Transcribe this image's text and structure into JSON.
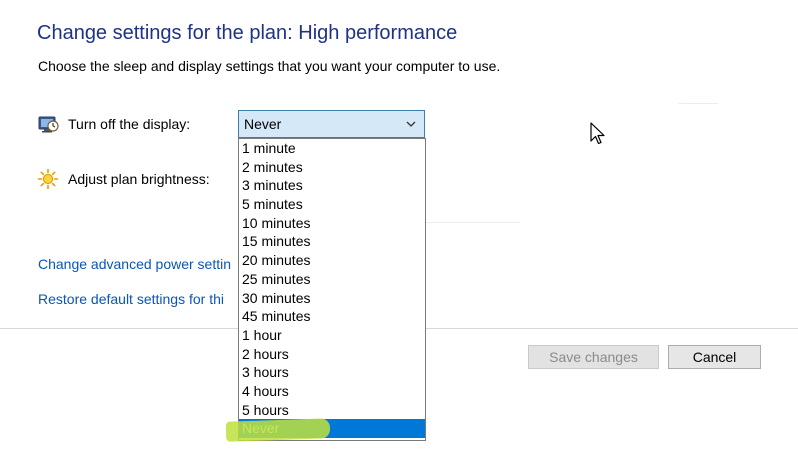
{
  "page": {
    "title": "Change settings for the plan: High performance",
    "subtitle": "Choose the sleep and display settings that you want your computer to use."
  },
  "settings": {
    "display": {
      "label": "Turn off the display:",
      "icon": "monitor-clock-icon",
      "value": "Never"
    },
    "brightness": {
      "label": "Adjust plan brightness:",
      "icon": "sun-icon"
    }
  },
  "dropdown": {
    "options": [
      "1 minute",
      "2 minutes",
      "3 minutes",
      "5 minutes",
      "10 minutes",
      "15 minutes",
      "20 minutes",
      "25 minutes",
      "30 minutes",
      "45 minutes",
      "1 hour",
      "2 hours",
      "3 hours",
      "4 hours",
      "5 hours",
      "Never"
    ],
    "selected": "Never",
    "highlight_color": "#0078d7"
  },
  "links": {
    "advanced": "Change advanced power settin",
    "restore": "Restore default settings for thi"
  },
  "buttons": {
    "save": "Save changes",
    "cancel": "Cancel"
  },
  "colors": {
    "title": "#1e3287",
    "link": "#0a55b8",
    "annotation": "#bee13c"
  }
}
